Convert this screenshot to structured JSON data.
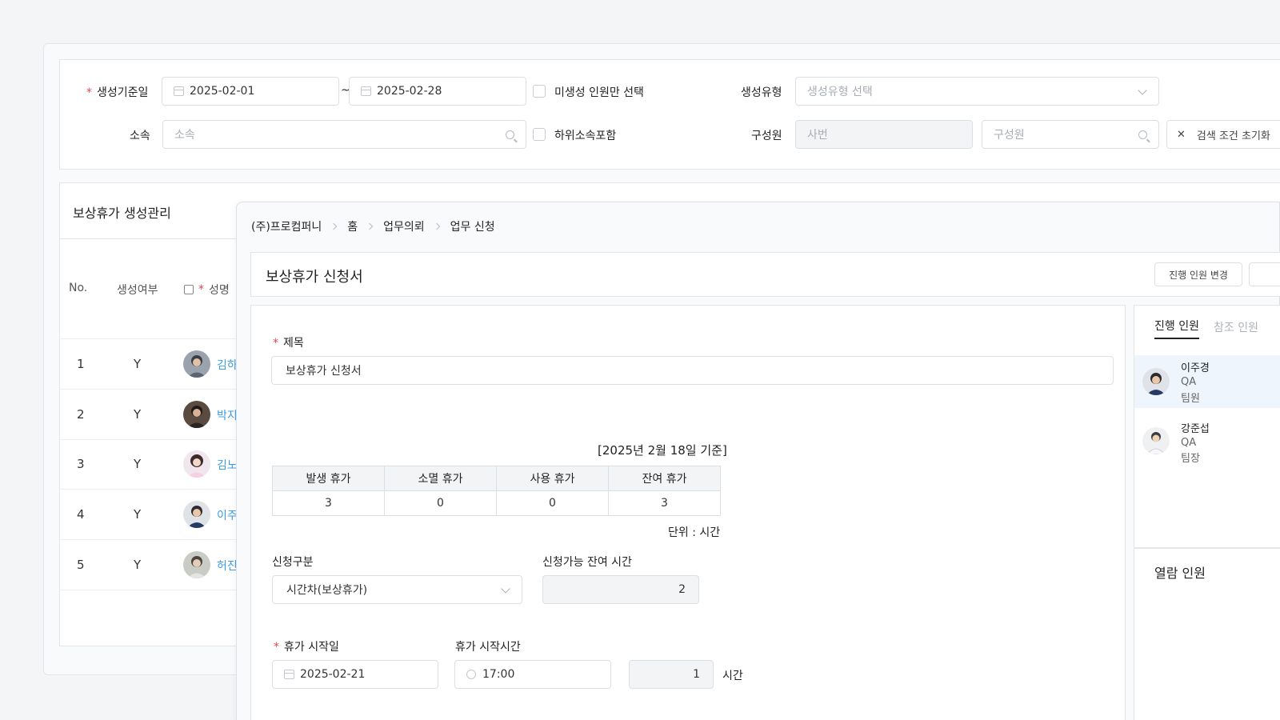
{
  "filter": {
    "date_label": "생성기준일",
    "date_start": "2025-02-01",
    "date_sep": "~",
    "date_end": "2025-02-28",
    "ungenerated_only": "미생성 인원만 선택",
    "type_label": "생성유형",
    "type_placeholder": "생성유형 선택",
    "dept_label": "소속",
    "dept_placeholder": "소속",
    "include_sub": "하위소속포함",
    "member_label": "구성원",
    "emp_no_placeholder": "사번",
    "member_placeholder": "구성원",
    "reset_label": "검색 조건 초기화"
  },
  "grid": {
    "title": "보상휴가 생성관리",
    "columns": {
      "no": "No.",
      "generated": "생성여부",
      "name": "성명"
    },
    "rows": [
      {
        "no": "1",
        "generated": "Y",
        "name": "김하"
      },
      {
        "no": "2",
        "generated": "Y",
        "name": "박지"
      },
      {
        "no": "3",
        "generated": "Y",
        "name": "김노"
      },
      {
        "no": "4",
        "generated": "Y",
        "name": "이주"
      },
      {
        "no": "5",
        "generated": "Y",
        "name": "허진"
      }
    ]
  },
  "modal": {
    "breadcrumb": [
      "(주)프로컴퍼니",
      "홈",
      "업무의뢰",
      "업무 신청"
    ],
    "title": "보상휴가 신청서",
    "change_approver_btn": "진행 인원 변경",
    "form": {
      "subject_label": "제목",
      "subject_value": "보상휴가 신청서",
      "basis_caption": "[2025년 2월 18일 기준]",
      "leave_table": {
        "headers": [
          "발생 휴가",
          "소멸 휴가",
          "사용 휴가",
          "잔여 휴가"
        ],
        "values": [
          "3",
          "0",
          "0",
          "3"
        ]
      },
      "unit_note": "단위 : 시간",
      "category_label": "신청구분",
      "category_value": "시간차(보상휴가)",
      "remaining_label": "신청가능 잔여 시간",
      "remaining_value": "2",
      "start_date_label": "휴가 시작일",
      "start_date_value": "2025-02-21",
      "start_time_label": "휴가 시작시간",
      "start_time_value": "17:00",
      "hours_value": "1",
      "hours_unit": "시간"
    },
    "side": {
      "tab_active": "진행 인원",
      "tab_inactive": "참조 인원",
      "approvers": [
        {
          "name": "이주경",
          "team": "QA",
          "role": "팀원"
        },
        {
          "name": "강준섭",
          "team": "QA",
          "role": "팀장"
        }
      ],
      "viewers_title": "열람 인원"
    }
  },
  "colors": {
    "accent_link": "#3b9ce8",
    "required": "#e5484d",
    "border": "#dcdfe4"
  }
}
